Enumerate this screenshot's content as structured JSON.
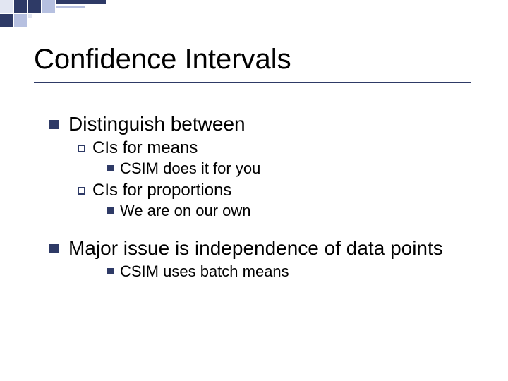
{
  "slide": {
    "title": "Confidence Intervals",
    "bullets": {
      "b1": "Distinguish between",
      "b1a": "CIs for means",
      "b1a1": "CSIM does it for you",
      "b1b": "CIs for proportions",
      "b1b1": "We are on our own",
      "b2": "Major issue is independence of data points",
      "b2a1": "CSIM uses batch means"
    }
  }
}
